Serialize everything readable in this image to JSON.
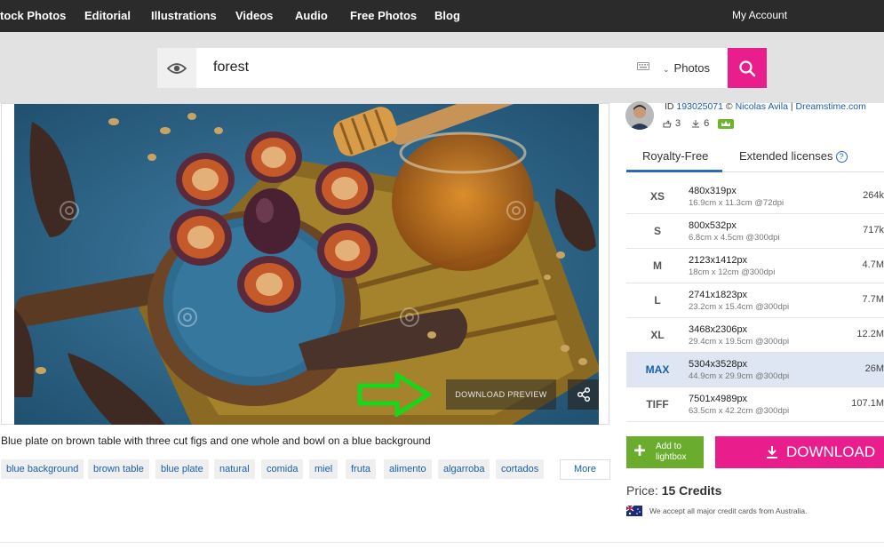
{
  "nav": {
    "items": [
      "tock Photos",
      "Editorial",
      "Illustrations",
      "Videos",
      "Audio",
      "Free Photos",
      "Blog"
    ],
    "account": "My Account"
  },
  "search": {
    "query": "forest",
    "type": "Photos"
  },
  "image": {
    "download_preview": "DOWNLOAD PREVIEW",
    "caption": "Blue plate on brown table with three cut figs and one whole and bowl on a blue background"
  },
  "tags": [
    "blue background",
    "brown table",
    "blue plate",
    "natural",
    "comida",
    "miel",
    "fruta",
    "alimento",
    "algarroba",
    "cortados"
  ],
  "more_label": "More",
  "author": {
    "id_label": "ID",
    "id": "193025071",
    "copyright": "©",
    "name": "Nicolas Avila",
    "separator": "|",
    "site": "Dreamstime.com",
    "likes": "3",
    "downloads": "6"
  },
  "licenses": {
    "active": "Royalty-Free",
    "other": "Extended licenses",
    "help": "?"
  },
  "sizes": [
    {
      "code": "XS",
      "px": "480x319px",
      "dim": "16.9cm x 11.3cm @72dpi",
      "size": "264k"
    },
    {
      "code": "S",
      "px": "800x532px",
      "dim": "6.8cm x 4.5cm @300dpi",
      "size": "717k"
    },
    {
      "code": "M",
      "px": "2123x1412px",
      "dim": "18cm x 12cm @300dpi",
      "size": "4.7M"
    },
    {
      "code": "L",
      "px": "2741x1823px",
      "dim": "23.2cm x 15.4cm @300dpi",
      "size": "7.7M"
    },
    {
      "code": "XL",
      "px": "3468x2306px",
      "dim": "29.4cm x 19.5cm @300dpi",
      "size": "12.2M"
    },
    {
      "code": "MAX",
      "px": "5304x3528px",
      "dim": "44.9cm x 29.9cm @300dpi",
      "size": "26M"
    },
    {
      "code": "TIFF",
      "px": "7501x4989px",
      "dim": "63.5cm x 42.2cm @300dpi",
      "size": "107.1M"
    }
  ],
  "actions": {
    "lightbox": "Add to lightbox",
    "download": "DOWNLOAD"
  },
  "price": {
    "label": "Price:",
    "value": "15 Credits"
  },
  "cards_note": "We accept all major credit cards from Australia.",
  "colors": {
    "accent": "#e91e8c",
    "green": "#6aac2b",
    "link": "#1a5eb3",
    "nav_bg": "#2b2b2b"
  }
}
